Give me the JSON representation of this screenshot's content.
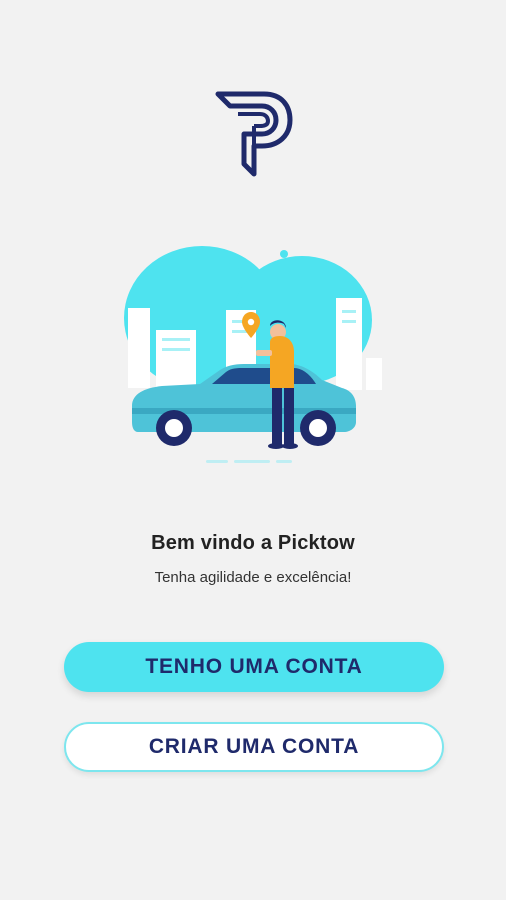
{
  "brand": {
    "logo_icon": "picktow-p-logo",
    "primary_color": "#1f2a6b",
    "accent_color": "#4ee3ef"
  },
  "illustration": {
    "icon": "car-and-person-illustration"
  },
  "welcome": {
    "title": "Bem vindo a Picktow",
    "subtitle": "Tenha agilidade e excelência!"
  },
  "actions": {
    "login_label": "TENHO UMA CONTA",
    "signup_label": "CRIAR UMA CONTA"
  }
}
